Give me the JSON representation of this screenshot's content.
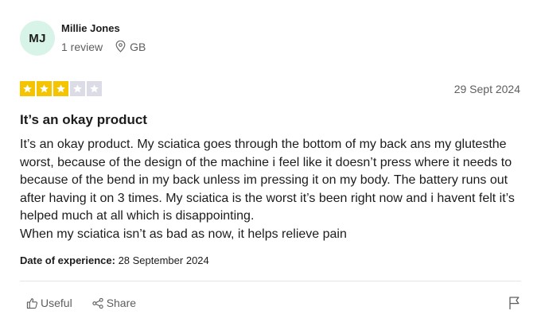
{
  "reviewer": {
    "initials": "MJ",
    "name": "Millie Jones",
    "review_count": "1 review",
    "country": "GB"
  },
  "review": {
    "rating": 3,
    "rating_max": 5,
    "date": "29 Sept 2024",
    "title": "It’s an okay product",
    "body_lines": [
      "It’s an okay product. My sciatica goes through the bottom of my back ans my glutesthe worst, because of the design of the machine i feel like it doesn’t press where it needs to because of the bend in my back unless im pressing it on my body. The battery runs out after having it on 3 times. My sciatica is the worst it’s been right now and i havent felt it’s helped much at all which is disappointing.",
      "When my sciatica isn’t as bad as now, it helps relieve pain"
    ],
    "experience_label": "Date of experience:",
    "experience_date": "28 September 2024"
  },
  "actions": {
    "useful_label": "Useful",
    "share_label": "Share"
  },
  "colors": {
    "star_on": "#f5c400",
    "star_off": "#dcdce6",
    "avatar_bg": "#d8f3e8"
  },
  "icons": [
    "location-pin-icon",
    "star-icon",
    "thumbs-up-icon",
    "share-icon",
    "flag-icon"
  ]
}
